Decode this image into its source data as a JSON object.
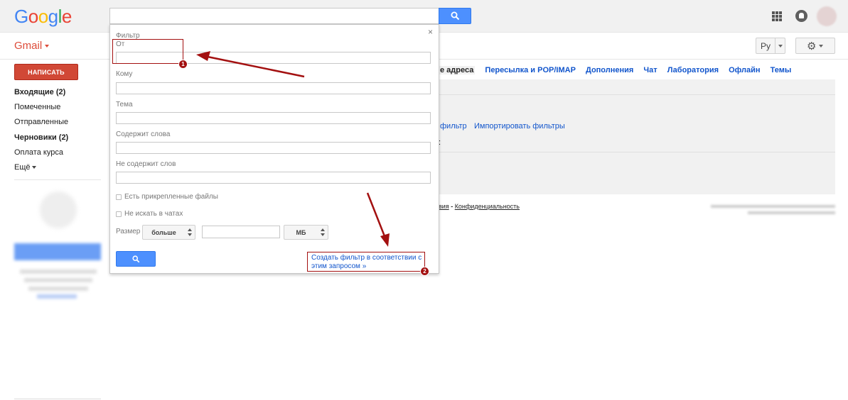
{
  "header": {
    "logo_letters": [
      {
        "ch": "G",
        "color": "#4285f4"
      },
      {
        "ch": "o",
        "color": "#ea4335"
      },
      {
        "ch": "o",
        "color": "#fbbc05"
      },
      {
        "ch": "g",
        "color": "#4285f4"
      },
      {
        "ch": "l",
        "color": "#34a853"
      },
      {
        "ch": "e",
        "color": "#ea4335"
      }
    ]
  },
  "app": {
    "name": "Gmail",
    "lang_label": "Ру"
  },
  "sidebar": {
    "compose_label": "НАПИСАТЬ",
    "items": [
      {
        "label": "Входящие (2)",
        "bold": true
      },
      {
        "label": "Помеченные",
        "bold": false
      },
      {
        "label": "Отправленные",
        "bold": false
      },
      {
        "label": "Черновики (2)",
        "bold": true
      },
      {
        "label": "Оплата курса",
        "bold": false
      },
      {
        "label": "Ещё",
        "bold": false
      }
    ]
  },
  "settings": {
    "tabs": [
      "е адреса",
      "Пересылка и POP/IMAP",
      "Дополнения",
      "Чат",
      "Лаборатория",
      "Офлайн",
      "Темы"
    ],
    "filter_link": "фильтр",
    "import_link": "Импортировать фильтры",
    "colon_text": ":",
    "footer": {
      "prefix": "вия",
      "separator": " - ",
      "privacy": "Конфиденциальность"
    }
  },
  "filter_popup": {
    "title": "Фильтр",
    "close": "×",
    "fields": [
      {
        "label": "От"
      },
      {
        "label": "Кому"
      },
      {
        "label": "Тема"
      },
      {
        "label": "Содержит слова"
      },
      {
        "label": "Не содержит слов"
      }
    ],
    "checkboxes": [
      "Есть прикрепленные файлы",
      "Не искать в чатах"
    ],
    "size_label": "Размер",
    "size_compare": "больше",
    "size_unit": "МБ",
    "create_filter_link": "Создать фильтр в соответствии с этим запросом »"
  },
  "annotations": {
    "badge_1": "1",
    "badge_2": "2",
    "color": "#a31010"
  }
}
